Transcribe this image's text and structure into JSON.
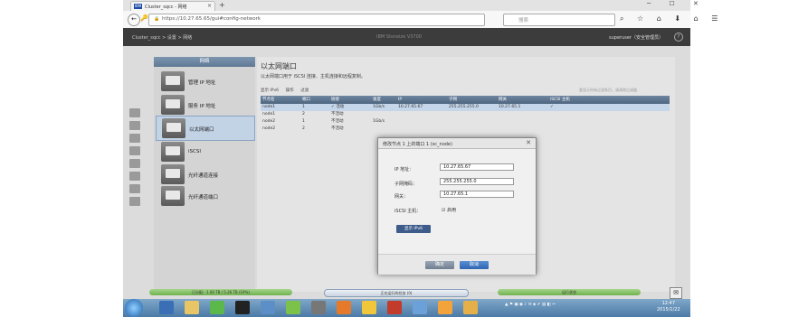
{
  "browser": {
    "tab_title": "Cluster_sqcc - 网络",
    "url": "https://10.27.65.65/gui#config-network",
    "search_placeholder": "搜索",
    "new_tab": "+",
    "window_controls": "─ ☐ ✕",
    "nav_icons": "⌕ ☆ ⌂ ⬇ ⌂ ☰"
  },
  "app_header": {
    "breadcrumb": "Cluster_sqcc  >  设置  >  网络",
    "product": "IBM Storwize V3700",
    "user": "superuser（安全管理员）",
    "help": "?"
  },
  "nav": {
    "title": "网络",
    "items": [
      {
        "label": "管理 IP 地址"
      },
      {
        "label": "服务 IP 地址"
      },
      {
        "label": "以太网端口"
      },
      {
        "label": "iSCSI"
      },
      {
        "label": "光纤通道连接"
      },
      {
        "label": "光纤通道端口"
      }
    ]
  },
  "content": {
    "title": "以太网端口",
    "description": "以太网端口用于 iSCSI 连接、主机连接和远程复制。",
    "toolbar": [
      "显示 IPv6",
      "操作",
      "过滤"
    ],
    "filter_hint": "要显示所有过滤条目，请清除过滤器",
    "columns": [
      "节点名",
      "端口",
      "链接",
      "速度",
      "IP",
      "子网",
      "网关",
      "iSCSI 主机"
    ],
    "rows": [
      [
        "node1",
        "1",
        "✓ 活动",
        "1Gb/s",
        "10.27.65.67",
        "255.255.255.0",
        "10.27.65.1",
        "✓"
      ],
      [
        "node1",
        "2",
        "不活动",
        "",
        "",
        "",
        "",
        ""
      ],
      [
        "node2",
        "1",
        "不活动",
        "1Gb/s",
        "",
        "",
        "",
        ""
      ],
      [
        "node2",
        "2",
        "不活动",
        "",
        "",
        "",
        "",
        ""
      ]
    ]
  },
  "dialog": {
    "title": "修改节点 1 上的端口 1 (sc_node)",
    "close": "✕",
    "fields": [
      {
        "label": "IP 地址：",
        "value": "10.27.65.67"
      },
      {
        "label": "子网掩码：",
        "value": "255.255.255.0"
      },
      {
        "label": "网关：",
        "value": "10.27.65.1"
      }
    ],
    "iscsi_label": "iSCSI 主机：",
    "iscsi_check": "☑ 启用",
    "ipv6_button": "显示 IPv6",
    "ok": "确定",
    "cancel": "取消"
  },
  "status": {
    "left": "已分配：1.00 TB / 5.26 TB (19%)",
    "middle": "正在运行的任务 (0)",
    "right": "运行状态"
  },
  "taskbar": {
    "time": "12:47",
    "date": "2015/1/22"
  }
}
